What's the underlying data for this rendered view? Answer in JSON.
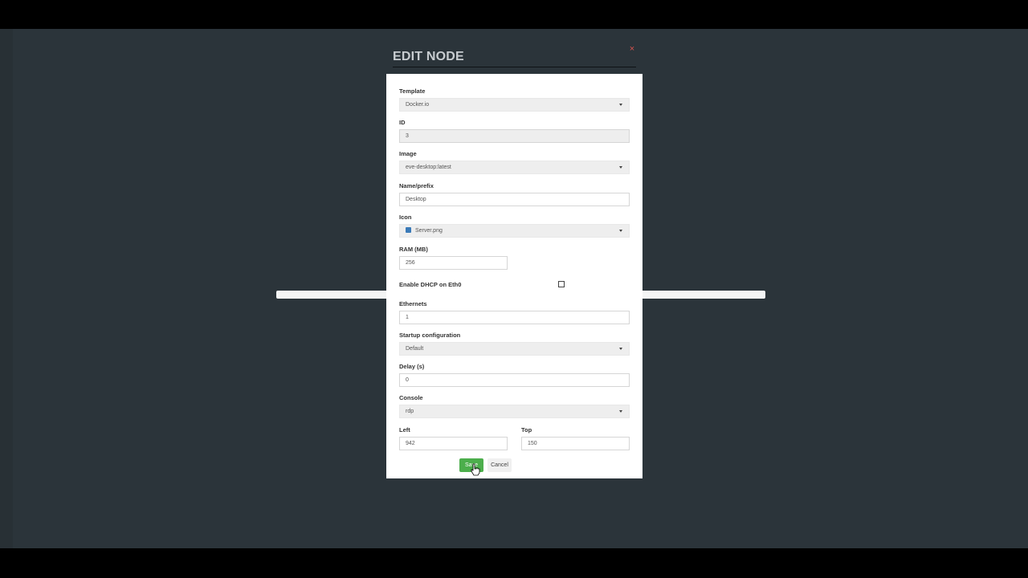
{
  "modal": {
    "title": "EDIT NODE",
    "close_glyph": "×",
    "accent_close": "#d9534f"
  },
  "form": {
    "template": {
      "label": "Template",
      "value": "Docker.io"
    },
    "id": {
      "label": "ID",
      "value": "3"
    },
    "image": {
      "label": "Image",
      "value": "eve-desktop:latest"
    },
    "name": {
      "label": "Name/prefix",
      "value": "Desktop"
    },
    "icon": {
      "label": "Icon",
      "value": "Server.png",
      "icon": "server-icon"
    },
    "ram": {
      "label": "RAM (MB)",
      "value": "256"
    },
    "dhcp": {
      "label": "Enable DHCP on Eth0",
      "checked": false
    },
    "ethernets": {
      "label": "Ethernets",
      "value": "1"
    },
    "startup": {
      "label": "Startup configuration",
      "value": "Default"
    },
    "delay": {
      "label": "Delay (s)",
      "value": "0"
    },
    "console": {
      "label": "Console",
      "value": "rdp"
    },
    "left": {
      "label": "Left",
      "value": "942"
    },
    "top": {
      "label": "Top",
      "value": "150"
    }
  },
  "buttons": {
    "save": "Save",
    "cancel": "Cancel",
    "save_color": "#4cae4c"
  }
}
